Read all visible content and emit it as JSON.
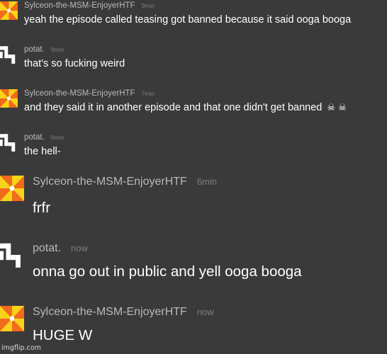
{
  "messages": [
    {
      "user": "Sylceon-the-MSM-EnjoyerHTF",
      "time": "9min",
      "text": "yeah the episode called teasing got banned because it said ooga booga",
      "avatar": "sunburst-icon"
    },
    {
      "user": "potat.",
      "time": "9min",
      "text": "that's so fucking weird",
      "avatar": "pixel-glyph-icon"
    },
    {
      "user": "Sylceon-the-MSM-EnjoyerHTF",
      "time": "7min",
      "text": "and they said it in another episode and that one didn't get banned",
      "emoji": "☠ ☠",
      "avatar": "sunburst-icon"
    },
    {
      "user": "potat.",
      "time": "6min",
      "text": "the hell-",
      "avatar": "pixel-glyph-icon"
    },
    {
      "user": "Sylceon-the-MSM-EnjoyerHTF",
      "time": "6min",
      "text": "frfr",
      "avatar": "sunburst-icon"
    },
    {
      "user": "potat.",
      "time": "now",
      "text": "onna go out in public and yell ooga booga",
      "avatar": "pixel-glyph-icon"
    },
    {
      "user": "Sylceon-the-MSM-EnjoyerHTF",
      "time": "now",
      "text": "HUGE W",
      "avatar": "sunburst-icon"
    }
  ],
  "watermark": "imgflip.com",
  "colors": {
    "background": "#3a3a3a",
    "username": "#b9b9b9",
    "timestamp": "#7e7e7e",
    "sun_orange": "#f26a1b",
    "sun_yellow": "#f9d21a"
  }
}
